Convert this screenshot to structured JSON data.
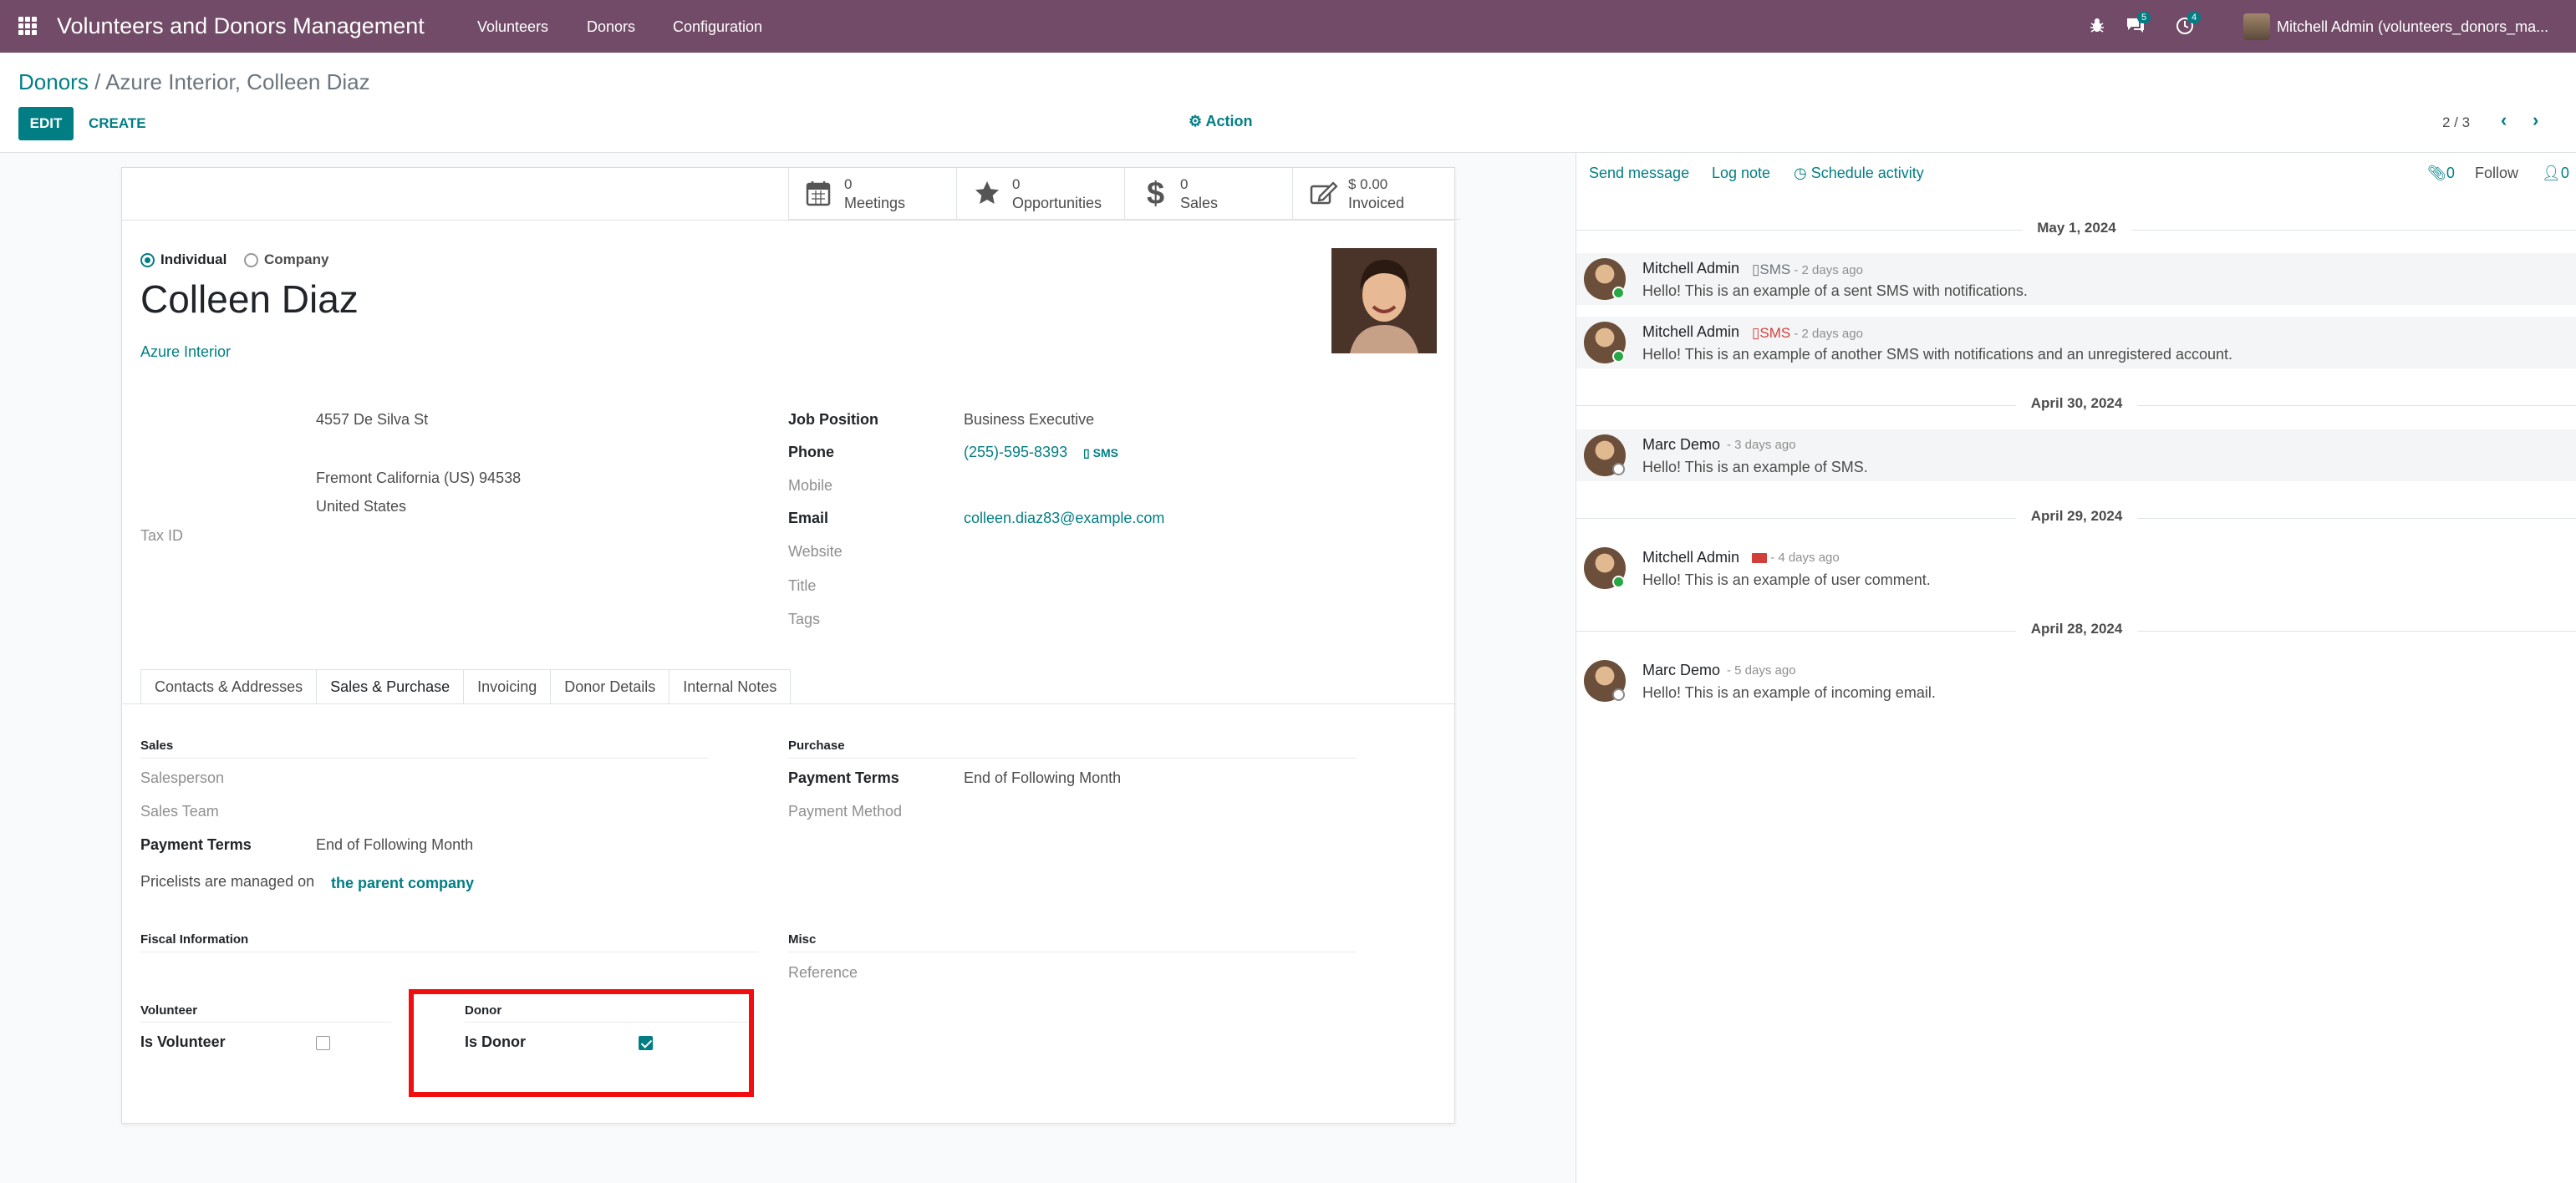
{
  "navbar": {
    "app_title": "Volunteers and Donors Management",
    "menus": [
      "Volunteers",
      "Donors",
      "Configuration"
    ],
    "messages_badge": "5",
    "activities_badge": "4",
    "user": "Mitchell Admin (volunteers_donors_ma..."
  },
  "control_panel": {
    "breadcrumb_parent": "Donors",
    "breadcrumb_sep": "/",
    "breadcrumb_current": "Azure Interior, Colleen Diaz",
    "edit_label": "EDIT",
    "create_label": "CREATE",
    "action_label": "Action",
    "pager": "2 / 3"
  },
  "stat_buttons": [
    {
      "icon": "calendar-icon",
      "value": "0",
      "label": "Meetings"
    },
    {
      "icon": "star-icon",
      "value": "0",
      "label": "Opportunities"
    },
    {
      "icon": "dollar-icon",
      "value": "0",
      "label": "Sales"
    },
    {
      "icon": "invoice-icon",
      "value": "$ 0.00",
      "label": "Invoiced"
    }
  ],
  "partner": {
    "type_individual": "Individual",
    "type_company": "Company",
    "name": "Colleen Diaz",
    "company": "Azure Interior",
    "address": {
      "street": "4557 De Silva St",
      "city_line": "Fremont  California (US)  94538",
      "country": "United States"
    },
    "tax_id_label": "Tax ID",
    "job_position_label": "Job Position",
    "job_position": "Business Executive",
    "phone_label": "Phone",
    "phone": "(255)-595-8393",
    "sms_label": "SMS",
    "mobile_label": "Mobile",
    "email_label": "Email",
    "email": "colleen.diaz83@example.com",
    "website_label": "Website",
    "title_label": "Title",
    "tags_label": "Tags"
  },
  "tabs": [
    "Contacts & Addresses",
    "Sales & Purchase",
    "Invoicing",
    "Donor Details",
    "Internal Notes"
  ],
  "active_tab": "Sales & Purchase",
  "sales": {
    "title": "Sales",
    "salesperson_label": "Salesperson",
    "sales_team_label": "Sales Team",
    "payment_terms_label": "Payment Terms",
    "payment_terms": "End of Following Month",
    "pricelist_text": "Pricelists are managed on",
    "pricelist_link": "the parent company"
  },
  "purchase": {
    "title": "Purchase",
    "payment_terms_label": "Payment Terms",
    "payment_terms": "End of Following Month",
    "payment_method_label": "Payment Method"
  },
  "fiscal": {
    "title": "Fiscal Information"
  },
  "misc": {
    "title": "Misc",
    "reference_label": "Reference"
  },
  "volunteer": {
    "title": "Volunteer",
    "is_volunteer_label": "Is Volunteer",
    "is_volunteer": false
  },
  "donor": {
    "title": "Donor",
    "is_donor_label": "Is Donor",
    "is_donor": true
  },
  "chatter": {
    "send_message": "Send message",
    "log_note": "Log note",
    "schedule_activity": "Schedule activity",
    "attachments_count": "0",
    "follow": "Follow",
    "followers_count": "0",
    "groups": [
      {
        "date": "May 1, 2024",
        "messages": [
          {
            "author": "Mitchell Admin",
            "kind": "SMS",
            "time": "- 2 days ago",
            "body": "Hello! This is an example of a sent SMS with notifications.",
            "online": true
          },
          {
            "author": "Mitchell Admin",
            "kind": "SMS",
            "time": "- 2 days ago",
            "body": "Hello! This is an example of another SMS with notifications and an unregistered account.",
            "online": true
          }
        ]
      },
      {
        "date": "April 30, 2024",
        "messages": [
          {
            "author": "Marc Demo",
            "time": "- 3 days ago",
            "body": "Hello! This is an example of SMS.",
            "online": false
          }
        ]
      },
      {
        "date": "April 29, 2024",
        "messages": [
          {
            "author": "Mitchell Admin",
            "time": "- 4 days ago",
            "body": "Hello! This is an example of user comment.",
            "online": true
          }
        ]
      },
      {
        "date": "April 28, 2024",
        "messages": [
          {
            "author": "Marc Demo",
            "time": "- 5 days ago",
            "body": "Hello! This is an example of incoming email.",
            "online": false
          }
        ]
      }
    ]
  },
  "colors": {
    "brand": "#714b67",
    "accent": "#017e84",
    "highlight": "#f00e0e"
  }
}
